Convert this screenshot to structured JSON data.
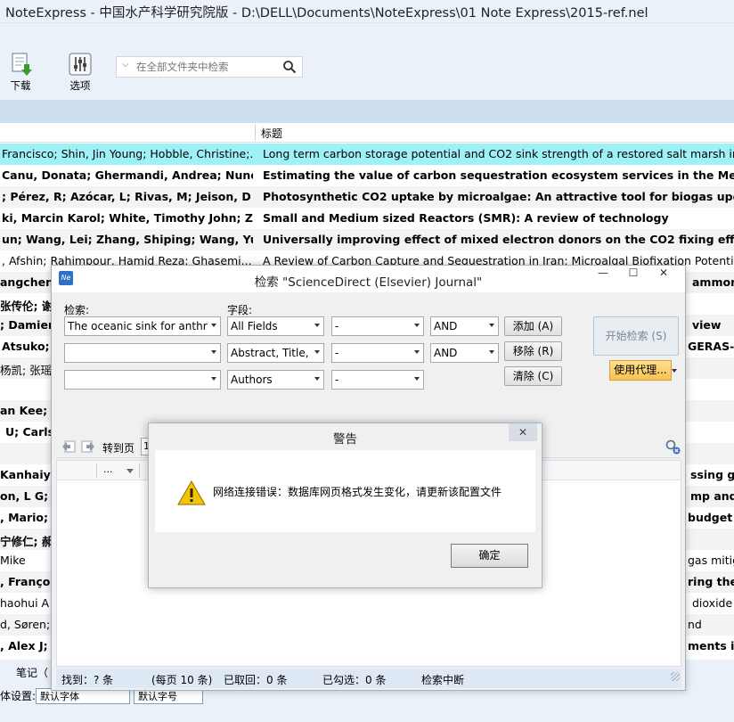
{
  "window": {
    "title": "NoteExpress - 中国水产科学研究院版 - D:\\DELL\\Documents\\NoteExpress\\01 Note Express\\2015-ref.nel"
  },
  "toolbar": {
    "download_label": "下载",
    "options_label": "选项",
    "search_placeholder": "在全部文件夹中检索"
  },
  "list": {
    "column_title": "标题",
    "rows": [
      {
        "authors": "Francisco; Shin, Jin Young; Hobble, Christine;...",
        "title": "Long term carbon storage potential and CO2 sink strength of a restored salt marsh in",
        "bold": false,
        "selected": true
      },
      {
        "authors": "Canu, Donata; Ghermandi, Andrea; Nunes,",
        "title": "Estimating the value of carbon sequestration ecosystem services in the Mediterran",
        "bold": true,
        "selected": false
      },
      {
        "authors": "; Pérez, R; Azócar, L; Rivas, M; Jeison, D",
        "title": "Photosynthetic CO2 uptake by microalgae: An attractive tool for biogas upgradi",
        "bold": true,
        "selected": false
      },
      {
        "authors": "ki, Marcin Karol; White, Timothy John; Zhac",
        "title": "Small and Medium sized Reactors (SMR): A review of technology",
        "bold": true,
        "selected": false
      },
      {
        "authors": "un; Wang, Lei; Zhang, Shiping; Wang, Yuan",
        "title": "Universally improving effect of mixed electron donors on the CO2 fixing efficien",
        "bold": true,
        "selected": false
      },
      {
        "authors": ", Afshin; Rahimpour, Hamid Reza; Ghasemi...",
        "title": "A Review of Carbon Capture and Sequestration in Iran: Microalgal Biofixation Potentia",
        "bold": false,
        "selected": false
      }
    ],
    "partial_rows": [
      {
        "left": "angchen",
        "right": "ammon",
        "bold": true
      },
      {
        "left": "张传伦; 谢",
        "right": "",
        "bold": true
      },
      {
        "left": "; Damien",
        "right": "view",
        "bold": true
      },
      {
        "left": "Atsuko;",
        "right": "GERAS-C",
        "bold": true
      },
      {
        "left": "杨凯; 张瑶;",
        "right": "",
        "bold": false
      },
      {
        "left": "",
        "right": "",
        "bold": false
      },
      {
        "left": "an Kee; L",
        "right": "",
        "bold": true
      },
      {
        "left": "U; Carls",
        "right": "",
        "bold": true
      },
      {
        "left": "",
        "right": "",
        "bold": false
      },
      {
        "left": "Kanhaiya;",
        "right": "ssing gl",
        "bold": true
      },
      {
        "left": "on, L G; T",
        "right": "mp and i",
        "bold": true
      },
      {
        "left": ", Mario;",
        "right": "budget",
        "bold": true
      },
      {
        "left": "宁修仁; 郝",
        "right": "",
        "bold": true
      },
      {
        "left": "Mike",
        "right": "gas mitig",
        "bold": false
      },
      {
        "left": ", François",
        "right": "ring the",
        "bold": true
      },
      {
        "left": "haohui A",
        "right": "dioxide",
        "bold": false
      },
      {
        "left": "d, Søren;",
        "right": "nd",
        "bold": false
      },
      {
        "left": ", Alex J;",
        "right": "ments in",
        "bold": true
      }
    ]
  },
  "bottom": {
    "notes_tab": "笔记（",
    "font_setting_label": "体设置:",
    "font_select_1": "默认字体",
    "font_select_2": "默认字号"
  },
  "search_dialog": {
    "title": "检索 \"ScienceDirect (Elsevier) Journal\"",
    "search_label": "检索:",
    "field_label": "字段:",
    "rows": [
      {
        "term": "The oceanic sink for anthr",
        "field": "All Fields",
        "op": "-",
        "logic": "AND"
      },
      {
        "term": "",
        "field": "Abstract, Title,",
        "op": "-",
        "logic": "AND"
      },
      {
        "term": "",
        "field": "Authors",
        "op": "-",
        "logic": ""
      }
    ],
    "add_button": "添加 (A)",
    "remove_button": "移除 (R)",
    "clear_button": "清除 (C)",
    "start_button": "开始检索 (S)",
    "proxy_button": "使用代理...",
    "goto_page_label": "转到页",
    "page_value": "1",
    "result_col_1": "...",
    "status": {
      "found": "找到：? 条",
      "per_page": "(每页 10 条)",
      "retrieved": "已取回：0 条",
      "checked": "已勾选：0 条",
      "state": "检索中断"
    }
  },
  "alert": {
    "title": "警告",
    "message": "网络连接错误：数据库网页格式发生变化，请更新该配置文件",
    "ok_button": "确定",
    "close_symbol": "✕"
  }
}
